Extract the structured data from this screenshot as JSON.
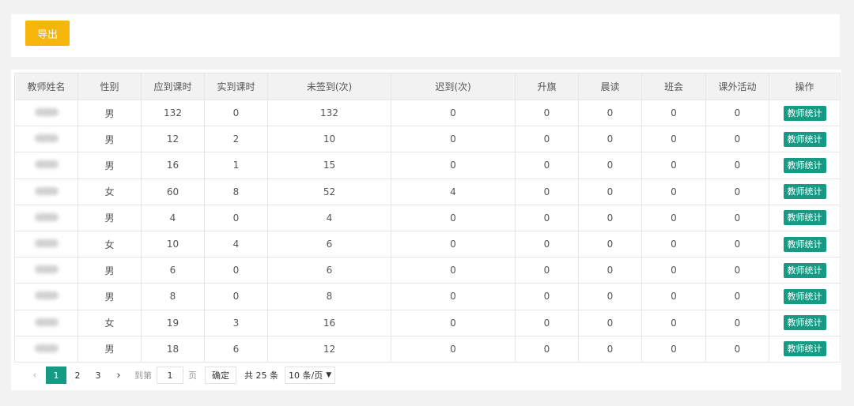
{
  "toolbar": {
    "export_label": "导出"
  },
  "table": {
    "headers": [
      "教师姓名",
      "性别",
      "应到课时",
      "实到课时",
      "未签到(次)",
      "迟到(次)",
      "升旗",
      "晨读",
      "班会",
      "课外活动",
      "操作"
    ],
    "action_label": "教师统计",
    "rows": [
      {
        "gender": "男",
        "expected": "132",
        "actual": "0",
        "unsigned": "132",
        "late": "0",
        "flag": "0",
        "morning": "0",
        "meeting": "0",
        "extra": "0"
      },
      {
        "gender": "男",
        "expected": "12",
        "actual": "2",
        "unsigned": "10",
        "late": "0",
        "flag": "0",
        "morning": "0",
        "meeting": "0",
        "extra": "0"
      },
      {
        "gender": "男",
        "expected": "16",
        "actual": "1",
        "unsigned": "15",
        "late": "0",
        "flag": "0",
        "morning": "0",
        "meeting": "0",
        "extra": "0"
      },
      {
        "gender": "女",
        "expected": "60",
        "actual": "8",
        "unsigned": "52",
        "late": "4",
        "flag": "0",
        "morning": "0",
        "meeting": "0",
        "extra": "0"
      },
      {
        "gender": "男",
        "expected": "4",
        "actual": "0",
        "unsigned": "4",
        "late": "0",
        "flag": "0",
        "morning": "0",
        "meeting": "0",
        "extra": "0"
      },
      {
        "gender": "女",
        "expected": "10",
        "actual": "4",
        "unsigned": "6",
        "late": "0",
        "flag": "0",
        "morning": "0",
        "meeting": "0",
        "extra": "0"
      },
      {
        "gender": "男",
        "expected": "6",
        "actual": "0",
        "unsigned": "6",
        "late": "0",
        "flag": "0",
        "morning": "0",
        "meeting": "0",
        "extra": "0"
      },
      {
        "gender": "男",
        "expected": "8",
        "actual": "0",
        "unsigned": "8",
        "late": "0",
        "flag": "0",
        "morning": "0",
        "meeting": "0",
        "extra": "0"
      },
      {
        "gender": "女",
        "expected": "19",
        "actual": "3",
        "unsigned": "16",
        "late": "0",
        "flag": "0",
        "morning": "0",
        "meeting": "0",
        "extra": "0"
      },
      {
        "gender": "男",
        "expected": "18",
        "actual": "6",
        "unsigned": "12",
        "late": "0",
        "flag": "0",
        "morning": "0",
        "meeting": "0",
        "extra": "0"
      }
    ]
  },
  "pagination": {
    "prev_icon": "chevron-left-icon",
    "next_icon": "chevron-right-icon",
    "pages": [
      "1",
      "2",
      "3"
    ],
    "current_page": "1",
    "goto_prefix": "到第",
    "goto_value": "1",
    "goto_suffix": "页",
    "confirm_label": "确定",
    "total_label": "共 25 条",
    "page_size_label": "10 条/页"
  },
  "colors": {
    "accent": "#169a84",
    "export": "#f5b50a"
  }
}
